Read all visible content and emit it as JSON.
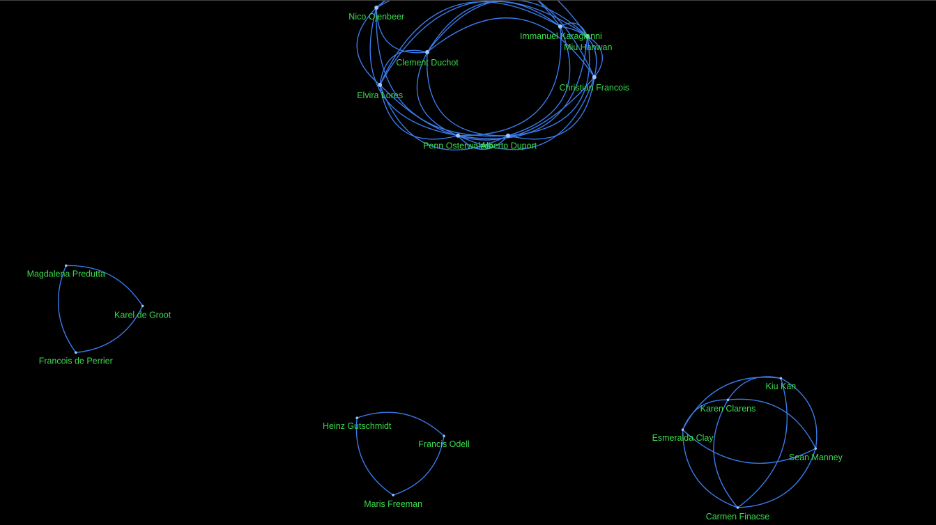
{
  "colors": {
    "background": "#000000",
    "edge": "#3a7bea",
    "node": "#9ec4ff",
    "label": "#3ddc4f"
  },
  "clusters": [
    {
      "id": "cluster-main",
      "nodes": [
        "Nico Ojenbeer",
        "Immanuel Karagianni",
        "Miu Hanwan",
        "Clement Duchot",
        "Elvira Lores",
        "Christian Francois",
        "Penn Osterwalder",
        "Alberto Duport"
      ],
      "connectivity": "all-pairs"
    },
    {
      "id": "cluster-left",
      "nodes": [
        "Magdalena Predutta",
        "Karel de Groot",
        "Francois de Perrier"
      ],
      "connectivity": "all-pairs"
    },
    {
      "id": "cluster-middle",
      "nodes": [
        "Heinz Gutschmidt",
        "Francis Odell",
        "Maris Freeman"
      ],
      "connectivity": "all-pairs"
    },
    {
      "id": "cluster-right",
      "nodes": [
        "Kiu Kan",
        "Karen Clarens",
        "Esmeralda Clay",
        "Sean Manney",
        "Carmen Finacse"
      ],
      "connectivity": "all-pairs"
    }
  ]
}
